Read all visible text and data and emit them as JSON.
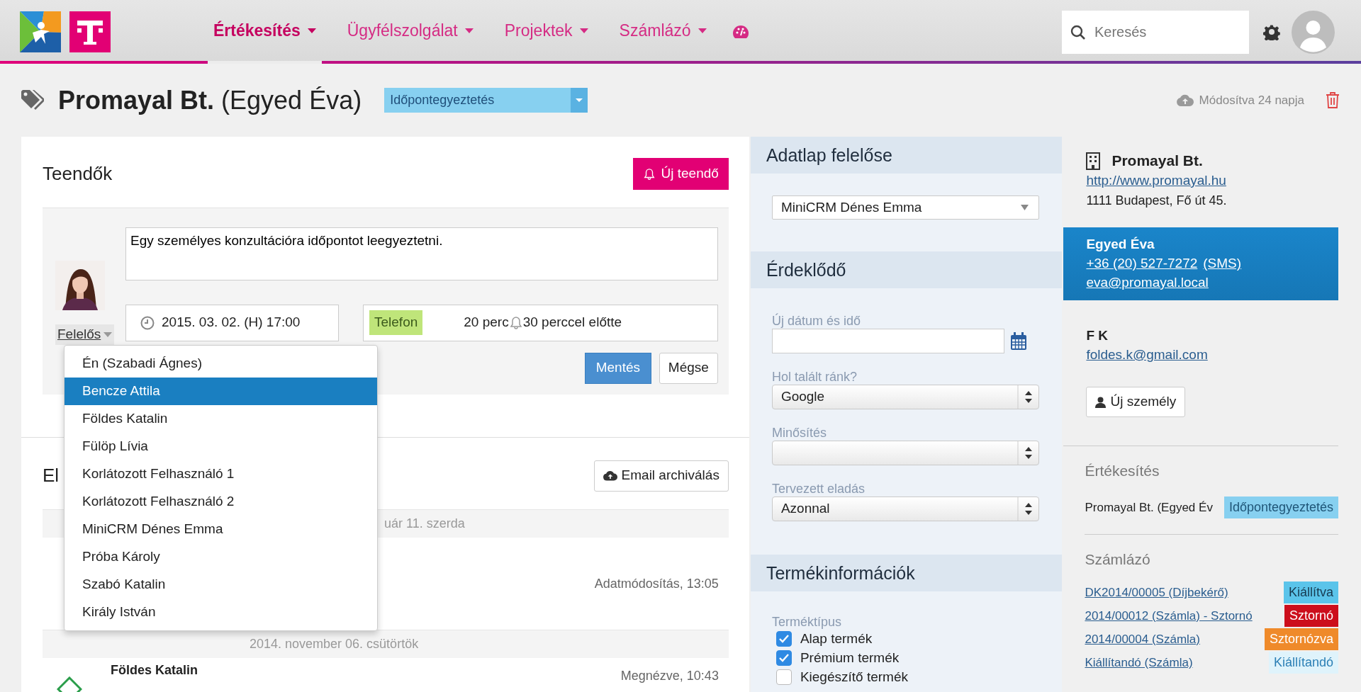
{
  "navbar": {
    "menu": [
      {
        "label": "Értékesítés",
        "selected": true
      },
      {
        "label": "Ügyfélszolgálat",
        "selected": false
      },
      {
        "label": "Projektek",
        "selected": false
      },
      {
        "label": "Számlázó",
        "selected": false
      }
    ],
    "search": {
      "placeholder": "Keresés"
    }
  },
  "header": {
    "company": "Promayal Bt.",
    "contact": "(Egyed Éva)",
    "status": "Időpontegyeztetés",
    "modified": "Módosítva 24 napja"
  },
  "todos": {
    "title": "Teendők",
    "new_button": "Új teendő",
    "task_text": "Egy személyes konzultációra időpontot leegyeztetni.",
    "date": "2015. 03. 02. (H) 17:00",
    "type_tag": "Telefon",
    "duration": "20 perc",
    "reminder": "30 perccel előtte",
    "owner_toggle": "Felelős",
    "save_button": "Mentés",
    "cancel_button": "Mégse",
    "owner_menu": [
      {
        "label": "Én (Szabadi Ágnes)",
        "selected": false
      },
      {
        "label": "Bencze Attila",
        "selected": true
      },
      {
        "label": "Földes Katalin",
        "selected": false
      },
      {
        "label": "Fülöp Lívia",
        "selected": false
      },
      {
        "label": "Korlátozott Felhasználó 1",
        "selected": false
      },
      {
        "label": "Korlátozott Felhasználó 2",
        "selected": false
      },
      {
        "label": "MiniCRM Dénes Emma",
        "selected": false
      },
      {
        "label": "Próba Károly",
        "selected": false
      },
      {
        "label": "Szabó Katalin",
        "selected": false
      },
      {
        "label": "Király István",
        "selected": false
      }
    ]
  },
  "history": {
    "title": "El",
    "archive_button": "Email archiválás",
    "entries": [
      {
        "kind": "date",
        "text": "uár 11. szerda"
      },
      {
        "kind": "event",
        "meta": "Adatmódosítás, 13:05"
      },
      {
        "kind": "date",
        "text": "2014. november 06. csütörtök"
      },
      {
        "kind": "event",
        "author": "Földes Katalin",
        "meta": "Megnézve, 10:43"
      }
    ]
  },
  "datasheet_owner": {
    "title": "Adatlap felelőse",
    "value": "MiniCRM Dénes Emma"
  },
  "lead": {
    "title": "Érdeklődő",
    "fields": [
      {
        "kind": "date",
        "label": "Új dátum és idő"
      },
      {
        "kind": "select",
        "label": "Hol talált ránk?",
        "value": "Google"
      },
      {
        "kind": "select",
        "label": "Minősítés"
      },
      {
        "kind": "select",
        "label": "Tervezett eladás",
        "value": "Azonnal"
      }
    ]
  },
  "product": {
    "title": "Termékinformációk",
    "label": "Terméktípus",
    "options": [
      {
        "label": "Alap termék",
        "checked": true
      },
      {
        "label": "Prémium termék",
        "checked": true
      },
      {
        "label": "Kiegészítő termék",
        "checked": false
      }
    ]
  },
  "company_card": {
    "name": "Promayal Bt.",
    "website": "http://www.promayal.hu",
    "address": "1111 Budapest, Fő út 45."
  },
  "contacts": [
    {
      "name": "Egyed Éva",
      "phone": "+36 (20) 527-7272",
      "sms": "(SMS)",
      "email": "eva@promayal.local",
      "selected": true
    },
    {
      "name": "F K",
      "email": "foldes.k@gmail.com",
      "selected": false
    }
  ],
  "new_person_button": "Új személy",
  "sales": {
    "title": "Értékesítés",
    "items": [
      {
        "name": "Promayal Bt. (Egyed Év",
        "status": "Időpontegyeztetés"
      }
    ]
  },
  "invoices": {
    "title": "Számlázó",
    "items": [
      {
        "label": "DK2014/00005 (Díjbekérő)",
        "status": "Kiállítva",
        "color": "#5bc4ea"
      },
      {
        "label": "2014/00012 (Számla) - Sztornó",
        "status": "Sztornó",
        "color": "#cc0e1c"
      },
      {
        "label": "2014/00004 (Számla)",
        "status": "Sztornózva",
        "color": "#ef8a2a"
      },
      {
        "label": "Kiállítandó (Számla)",
        "status": "Kiállítandó",
        "color": "#dff3fb"
      }
    ]
  }
}
